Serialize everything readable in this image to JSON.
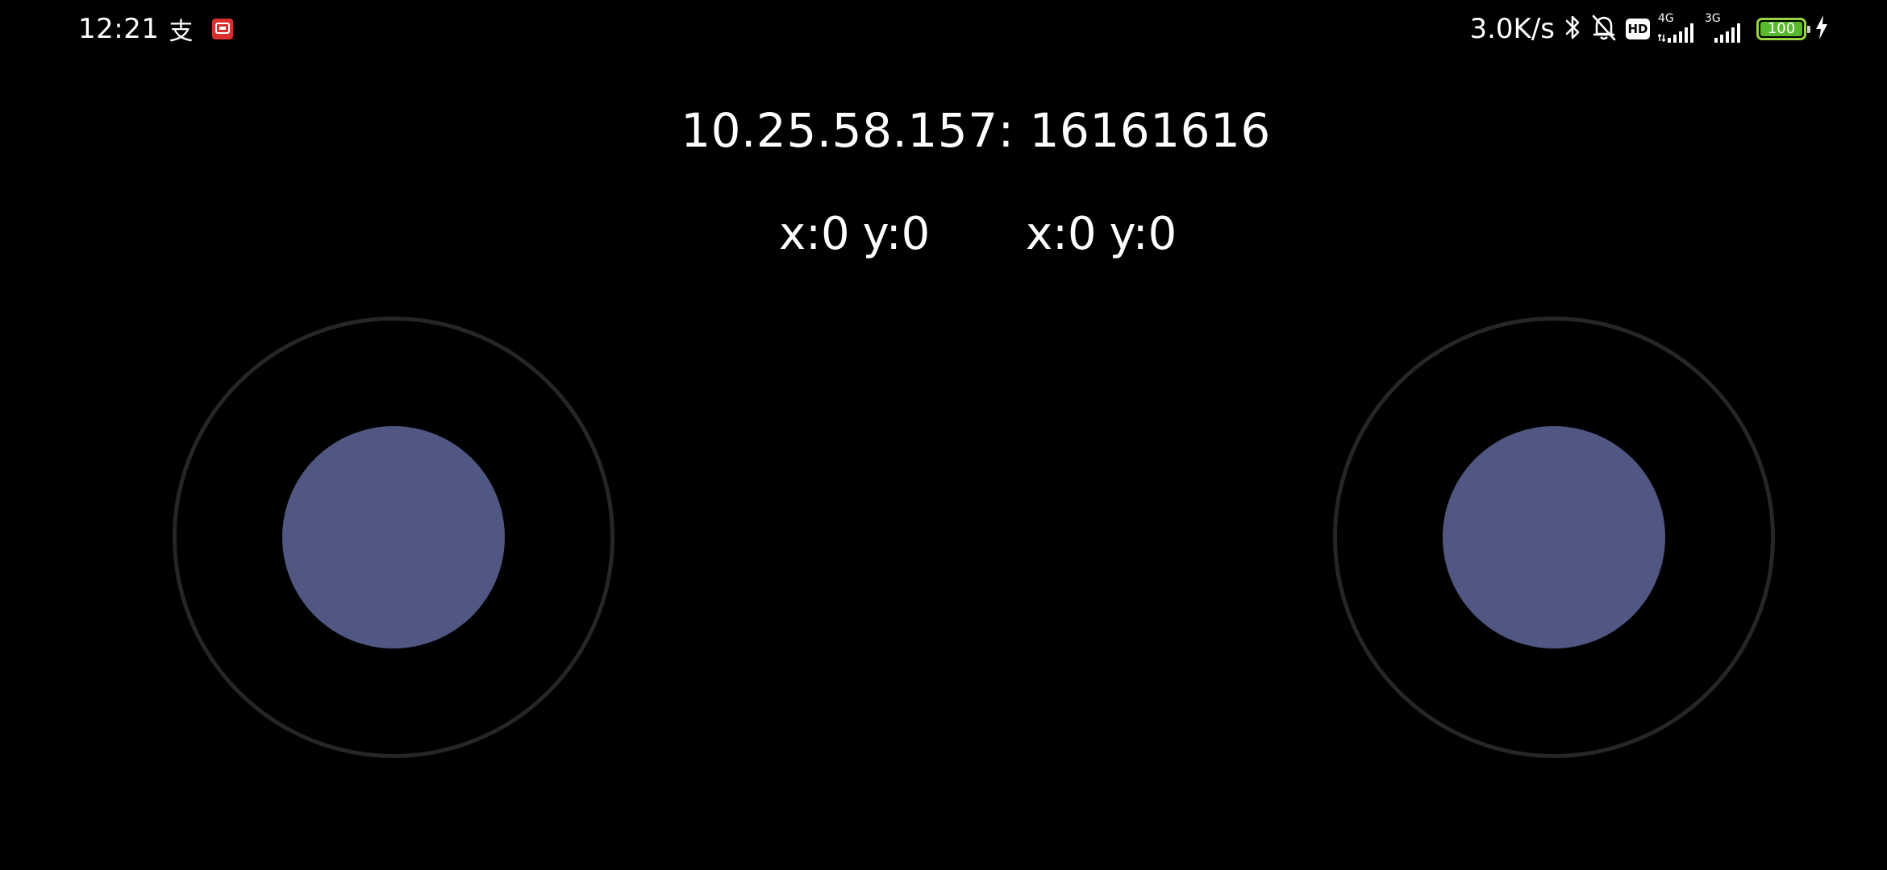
{
  "status_bar": {
    "time": "12:21",
    "notification_glyph": "支",
    "net_speed": "3.0K/s",
    "hd_label": "HD",
    "sim1_type": "4G",
    "sim2_type": "3G",
    "battery_level": "100",
    "battery_percent": 100,
    "icons": [
      "app-notification-icon",
      "bluetooth-icon",
      "mute-bell-icon",
      "hd-icon",
      "signal-icon",
      "signal-icon",
      "battery-icon",
      "charging-icon"
    ],
    "battery_color": "#9bd442",
    "app_icon_color": "#d9302c"
  },
  "main": {
    "connection": "10.25.58.157: 16161616",
    "left_stick": {
      "x_label": "x:0",
      "y_label": "y:0",
      "x": 0,
      "y": 0
    },
    "right_stick": {
      "x_label": "x:0",
      "y_label": "y:0",
      "x": 0,
      "y": 0
    }
  },
  "colors": {
    "background": "#000000",
    "knob": "#4f5782",
    "ring": "#262626",
    "text": "#ffffff"
  }
}
